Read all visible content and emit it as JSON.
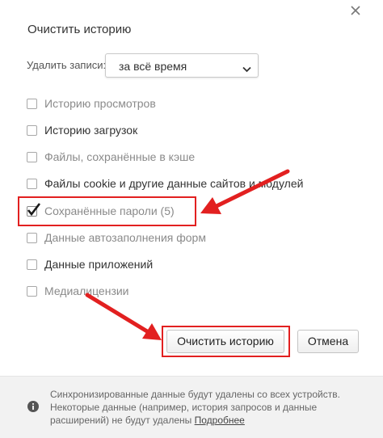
{
  "dialog": {
    "title": "Очистить историю",
    "delete_label": "Удалить записи:",
    "range_value": "за всё время"
  },
  "options": [
    {
      "label": "Историю просмотров",
      "checked": false
    },
    {
      "label": "Историю загрузок",
      "checked": false
    },
    {
      "label": "Файлы, сохранённые в кэше",
      "checked": false
    },
    {
      "label": "Файлы cookie и другие данные сайтов и модулей",
      "checked": false
    },
    {
      "label": "Сохранённые пароли (5)",
      "checked": true
    },
    {
      "label": "Данные автозаполнения форм",
      "checked": false
    },
    {
      "label": "Данные приложений",
      "checked": false
    },
    {
      "label": "Медиалицензии",
      "checked": false
    }
  ],
  "buttons": {
    "clear": "Очистить историю",
    "cancel": "Отмена"
  },
  "footer": {
    "line1": "Синхронизированные данные будут удалены со всех устройств.",
    "line2": "Некоторые данные (например, история запросов и данные",
    "line3_prefix": "расширений) не будут удалены",
    "more_link": "Подробнее"
  },
  "icons": {
    "close": "close-icon",
    "dropdown": "chevron-down-icon",
    "checkmark": "checkmark-icon",
    "info": "info-icon",
    "annotation": "red-arrow-icon"
  },
  "colors": {
    "annotation_red": "#e22020",
    "footer_bg": "#f2f2f2",
    "check_dark": "#1a1a1a"
  }
}
